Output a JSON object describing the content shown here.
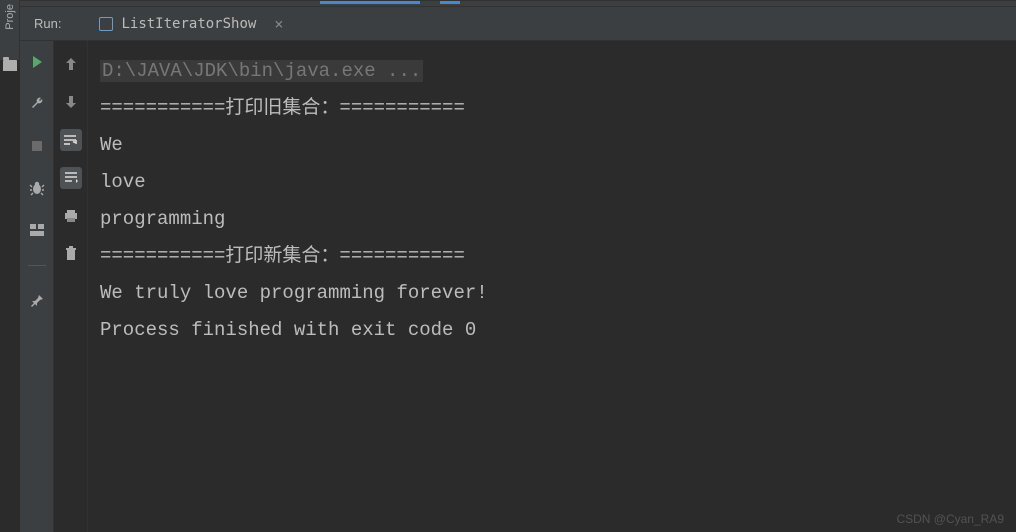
{
  "sidebar": {
    "project_label": "Proje"
  },
  "header": {
    "run_label": "Run:",
    "tab_name": "ListIteratorShow"
  },
  "console": {
    "command": "D:\\JAVA\\JDK\\bin\\java.exe ...",
    "lines": [
      "===========打印旧集合：===========",
      "We",
      "love",
      "programming",
      "===========打印新集合：===========",
      "We truly love programming forever!",
      "Process finished with exit code 0"
    ]
  },
  "watermark": "CSDN @Cyan_RA9",
  "icons": {
    "run": "run-icon",
    "wrench": "wrench-icon",
    "stop": "stop-icon",
    "bug": "bug-icon",
    "layout": "layout-icon",
    "pin": "pin-icon",
    "up": "arrow-up-icon",
    "down": "arrow-down-icon",
    "wrap": "soft-wrap-icon",
    "scroll": "scroll-to-end-icon",
    "print": "print-icon",
    "trash": "trash-icon"
  }
}
